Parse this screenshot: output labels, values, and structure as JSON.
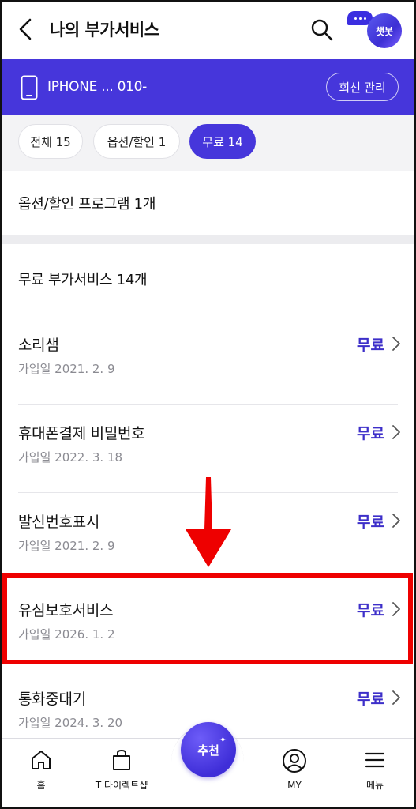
{
  "header": {
    "title": "나의 부가서비스",
    "chatbot_label": "챗봇"
  },
  "line": {
    "name": "IPHONE ...   010-",
    "manage_label": "회선 관리"
  },
  "filters": [
    {
      "label": "전체 15",
      "active": false
    },
    {
      "label": "옵션/할인 1",
      "active": false
    },
    {
      "label": "무료 14",
      "active": true
    }
  ],
  "sections": {
    "options_title": "옵션/할인 프로그램 1개",
    "free_title": "무료 부가서비스 14개"
  },
  "items": [
    {
      "name": "소리샘",
      "date": "가입일 2021. 2. 9",
      "price": "무료"
    },
    {
      "name": "휴대폰결제 비밀번호",
      "date": "가입일 2022. 3. 18",
      "price": "무료"
    },
    {
      "name": "발신번호표시",
      "date": "가입일 2021. 2. 9",
      "price": "무료"
    },
    {
      "name": "유심보호서비스",
      "date": "가입일 2026. 1. 2",
      "price": "무료",
      "highlighted": true
    },
    {
      "name": "통화중대기",
      "date": "가입일 2024. 3. 20",
      "price": "무료"
    }
  ],
  "bottom_nav": {
    "home": "홈",
    "shop": "T 다이렉트샵",
    "recommend": "추천",
    "my": "MY",
    "menu": "메뉴"
  },
  "colors": {
    "brand": "#4636db",
    "price": "#3d2fc9",
    "highlight": "#ee0000"
  }
}
